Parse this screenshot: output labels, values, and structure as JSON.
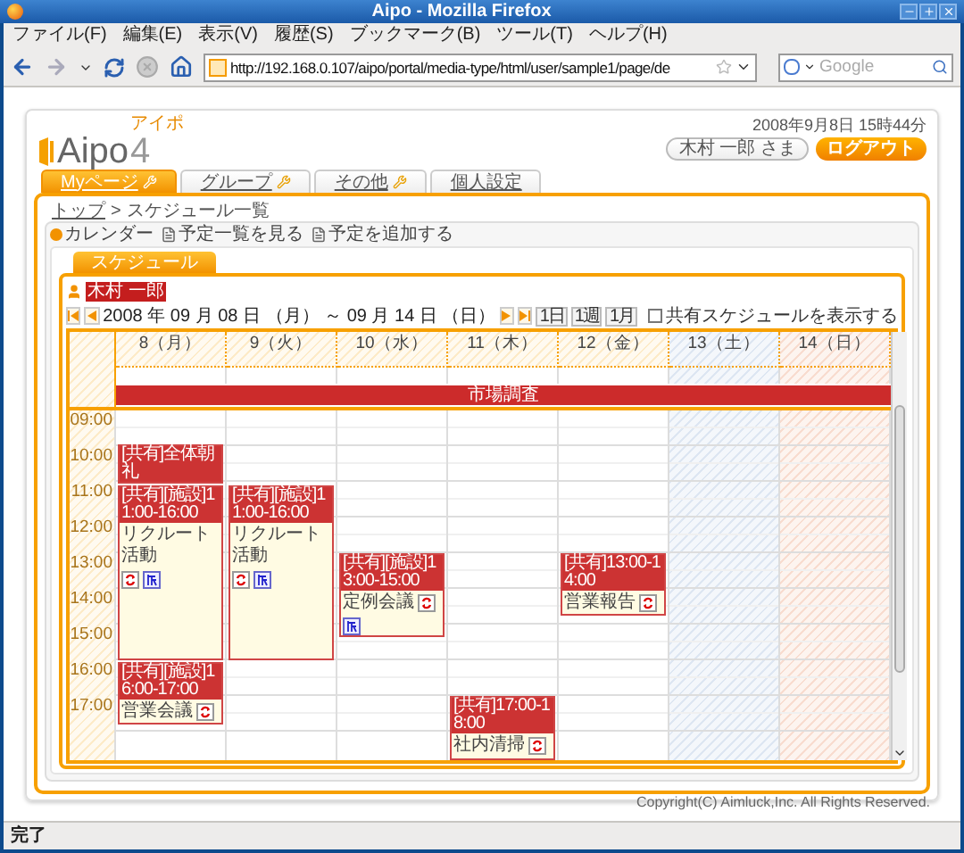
{
  "window": {
    "title": "Aipo - Mozilla Firefox"
  },
  "menu": [
    "ファイル(F)",
    "編集(E)",
    "表示(V)",
    "履歴(S)",
    "ブックマーク(B)",
    "ツール(T)",
    "ヘルプ(H)"
  ],
  "address_bar": {
    "value": "http://192.168.0.107/aipo/portal/media-type/html/user/sample1/page/de"
  },
  "search": {
    "placeholder": "Google"
  },
  "header": {
    "logo": "Aipo",
    "logo_version": "4",
    "logo_ruby": "アイポ",
    "datetime": "2008年9月8日 15時44分",
    "user": "木村 一郎 さま",
    "logout": "ログアウト"
  },
  "tabs": [
    {
      "label": "Myページ",
      "selected": true,
      "settings": true
    },
    {
      "label": "グループ",
      "selected": false,
      "settings": true
    },
    {
      "label": "その他",
      "selected": false,
      "settings": true
    },
    {
      "label": "個人設定",
      "selected": false,
      "settings": false
    }
  ],
  "breadcrumb": {
    "items": [
      "トップ",
      "スケジュール一覧"
    ],
    "separator": ">"
  },
  "toolbar": [
    {
      "label": "カレンダー",
      "kind": "menu"
    },
    {
      "label": "予定一覧を見る",
      "kind": "page"
    },
    {
      "label": "予定を追加する",
      "kind": "page"
    }
  ],
  "schedule": {
    "tab": "スケジュール",
    "user": "木村 一郎",
    "range": "2008 年 09 月 08 日 （月） ～ 09 月 14 日 （日）",
    "view_buttons": [
      "1日",
      "1週",
      "1月"
    ],
    "shared_checkbox": {
      "label": "共有スケジュールを表示する",
      "checked": false
    },
    "banner": "市場調査",
    "hours": [
      "09:00",
      "10:00",
      "11:00",
      "12:00",
      "13:00",
      "14:00",
      "15:00",
      "16:00",
      "17:00"
    ],
    "days": [
      {
        "label": "8（月）",
        "kind": "weekday",
        "events": [
          {
            "header": "[共有]全体朝礼"
          },
          {
            "header": "[共有][施設]11:00-16:00",
            "title": "リクルート活動",
            "repeat": true,
            "facility": true
          },
          {
            "header": "[共有][施設]16:00-17:00",
            "title": "営業会議",
            "repeat": true
          }
        ]
      },
      {
        "label": "9（火）",
        "kind": "weekday",
        "events": [
          {
            "header": "[共有][施設]11:00-16:00",
            "title": "リクルート活動",
            "repeat": true,
            "facility": true
          }
        ]
      },
      {
        "label": "10（水）",
        "kind": "weekday",
        "events": [
          {
            "header": "[共有][施設]13:00-15:00",
            "title": "定例会議",
            "repeat": true,
            "facility": true
          }
        ]
      },
      {
        "label": "11（木）",
        "kind": "weekday",
        "events": [
          {
            "header": "[共有]17:00-18:00",
            "title": "社内清掃",
            "repeat": true
          }
        ]
      },
      {
        "label": "12（金）",
        "kind": "weekday",
        "events": [
          {
            "header": "[共有]13:00-14:00",
            "title": "営業報告",
            "repeat": true
          }
        ]
      },
      {
        "label": "13（土）",
        "kind": "saturday"
      },
      {
        "label": "14（日）",
        "kind": "sunday"
      }
    ]
  },
  "footer": "Copyright(C) Aimluck,Inc. All Rights Reserved.",
  "status_bar": "完了"
}
